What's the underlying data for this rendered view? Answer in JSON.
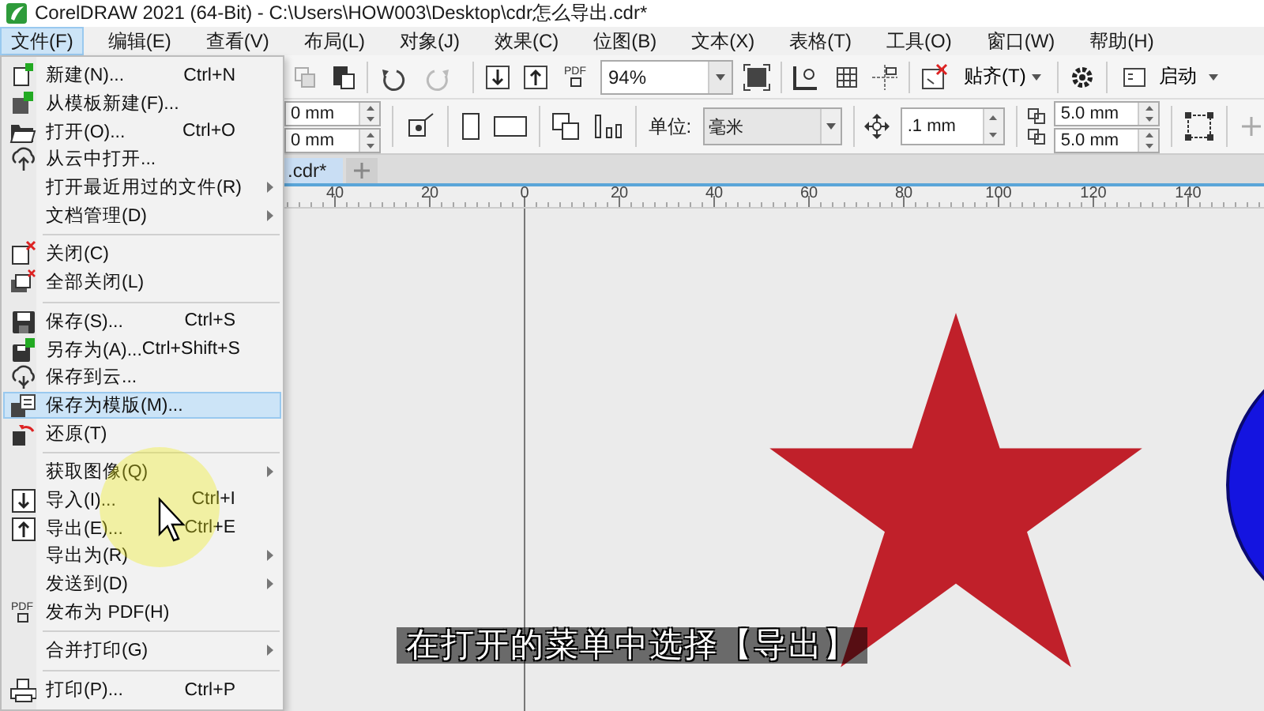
{
  "window": {
    "title": "CorelDRAW 2021 (64-Bit) - C:\\Users\\HOW003\\Desktop\\cdr怎么导出.cdr*"
  },
  "menu_bar": [
    {
      "label": "文件(F)",
      "selected": true
    },
    {
      "label": "编辑(E)",
      "selected": false
    },
    {
      "label": "查看(V)",
      "selected": false
    },
    {
      "label": "布局(L)",
      "selected": false
    },
    {
      "label": "对象(J)",
      "selected": false
    },
    {
      "label": "效果(C)",
      "selected": false
    },
    {
      "label": "位图(B)",
      "selected": false
    },
    {
      "label": "文本(X)",
      "selected": false
    },
    {
      "label": "表格(T)",
      "selected": false
    },
    {
      "label": "工具(O)",
      "selected": false
    },
    {
      "label": "窗口(W)",
      "selected": false
    },
    {
      "label": "帮助(H)",
      "selected": false
    }
  ],
  "toolbar": {
    "pdf_icon_text": "PDF",
    "zoom": "94%",
    "snap": "贴齐(T)",
    "launch": "启动"
  },
  "property_bar": {
    "x_field": "0 mm",
    "y_field": "0 mm",
    "units_label": "单位:",
    "units": "毫米",
    "nudge": ".1 mm",
    "dup_x": "5.0 mm",
    "dup_y": "5.0 mm"
  },
  "document_tabs": [
    {
      "label": ".cdr*",
      "selected": true
    }
  ],
  "ruler": {
    "labels": [
      "40",
      "20",
      "0",
      "20",
      "40",
      "60",
      "80",
      "100",
      "120",
      "140"
    ]
  },
  "file_menu": {
    "items": [
      {
        "kind": "item",
        "label": "新建(N)...",
        "shortcut": "Ctrl+N",
        "submenu": false,
        "selected": false
      },
      {
        "kind": "item",
        "label": "从模板新建(F)...",
        "submenu": false,
        "selected": false
      },
      {
        "kind": "item",
        "label": "打开(O)...",
        "shortcut": "Ctrl+O",
        "submenu": false,
        "selected": false
      },
      {
        "kind": "item",
        "label": "从云中打开...",
        "submenu": false,
        "selected": false
      },
      {
        "kind": "item",
        "label": "打开最近用过的文件(R)",
        "submenu": true,
        "selected": false
      },
      {
        "kind": "item",
        "label": "文档管理(D)",
        "submenu": true,
        "selected": false
      },
      {
        "kind": "separator"
      },
      {
        "kind": "item",
        "label": "关闭(C)",
        "submenu": false,
        "selected": false
      },
      {
        "kind": "item",
        "label": "全部关闭(L)",
        "submenu": false,
        "selected": false
      },
      {
        "kind": "separator"
      },
      {
        "kind": "item",
        "label": "保存(S)...",
        "shortcut": "Ctrl+S",
        "submenu": false,
        "selected": false
      },
      {
        "kind": "item",
        "label": "另存为(A)...",
        "shortcut": "Ctrl+Shift+S",
        "submenu": false,
        "selected": false
      },
      {
        "kind": "item",
        "label": "保存到云...",
        "submenu": false,
        "selected": false
      },
      {
        "kind": "item",
        "label": "保存为模版(M)...",
        "submenu": false,
        "selected": true
      },
      {
        "kind": "item",
        "label": "还原(T)",
        "submenu": false,
        "selected": false
      },
      {
        "kind": "separator"
      },
      {
        "kind": "item",
        "label": "获取图像(Q)",
        "submenu": true,
        "selected": false
      },
      {
        "kind": "item",
        "label": "导入(I)...",
        "shortcut": "Ctrl+I",
        "submenu": false,
        "selected": false
      },
      {
        "kind": "item",
        "label": "导出(E)...",
        "shortcut": "Ctrl+E",
        "submenu": false,
        "selected": false
      },
      {
        "kind": "item",
        "label": "导出为(R)",
        "submenu": true,
        "selected": false
      },
      {
        "kind": "item",
        "label": "发送到(D)",
        "submenu": true,
        "selected": false
      },
      {
        "kind": "item",
        "label": "发布为 PDF(H)",
        "icon_text": "PDF",
        "submenu": false,
        "selected": false
      },
      {
        "kind": "separator"
      },
      {
        "kind": "item",
        "label": "合并打印(G)",
        "submenu": true,
        "selected": false
      },
      {
        "kind": "separator"
      },
      {
        "kind": "item",
        "label": "打印(P)...",
        "shortcut": "Ctrl+P",
        "submenu": false,
        "selected": false
      }
    ]
  },
  "subtitle": "在打开的菜单中选择【导出】"
}
